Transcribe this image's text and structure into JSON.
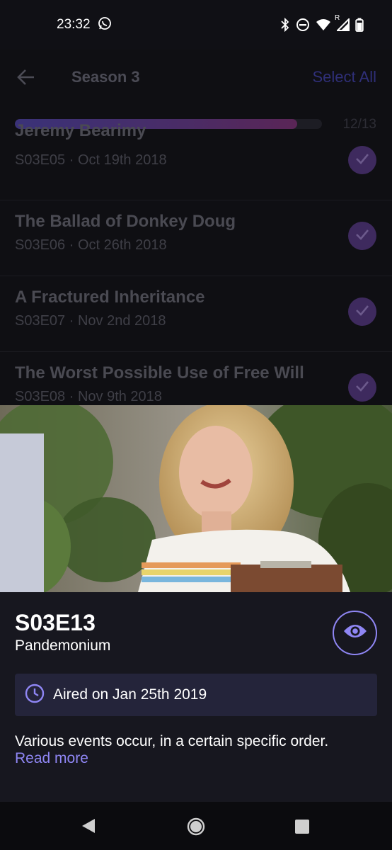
{
  "status": {
    "time": "23:32",
    "network_label": "R"
  },
  "app_bar": {
    "title": "Season 3",
    "select_all": "Select All"
  },
  "progress": {
    "watched": 12,
    "total": 13,
    "count_text": "12/13",
    "fraction": 0.92
  },
  "episodes": [
    {
      "title": "Jeremy Bearimy",
      "subtitle": "S03E05 · Oct 19th 2018",
      "watched": true
    },
    {
      "title": "The Ballad of Donkey Doug",
      "subtitle": "S03E06 · Oct 26th 2018",
      "watched": true
    },
    {
      "title": "A Fractured Inheritance",
      "subtitle": "S03E07 · Nov 2nd 2018",
      "watched": true
    },
    {
      "title": "The Worst Possible Use of Free Will",
      "subtitle": "S03E08 · Nov 9th 2018",
      "watched": true
    }
  ],
  "detail": {
    "code": "S03E13",
    "name": "Pandemonium",
    "aired": "Aired on Jan 25th 2019",
    "overview": "Various events occur, in a certain specific order.",
    "read_more": "Read more"
  },
  "colors": {
    "accent": "#8f86f4",
    "background": "#16161d",
    "aired_box": "#24243a"
  },
  "icons": {
    "back": "arrow-left-icon",
    "check": "check-icon",
    "watch": "eye-icon",
    "aired": "clock-icon"
  }
}
